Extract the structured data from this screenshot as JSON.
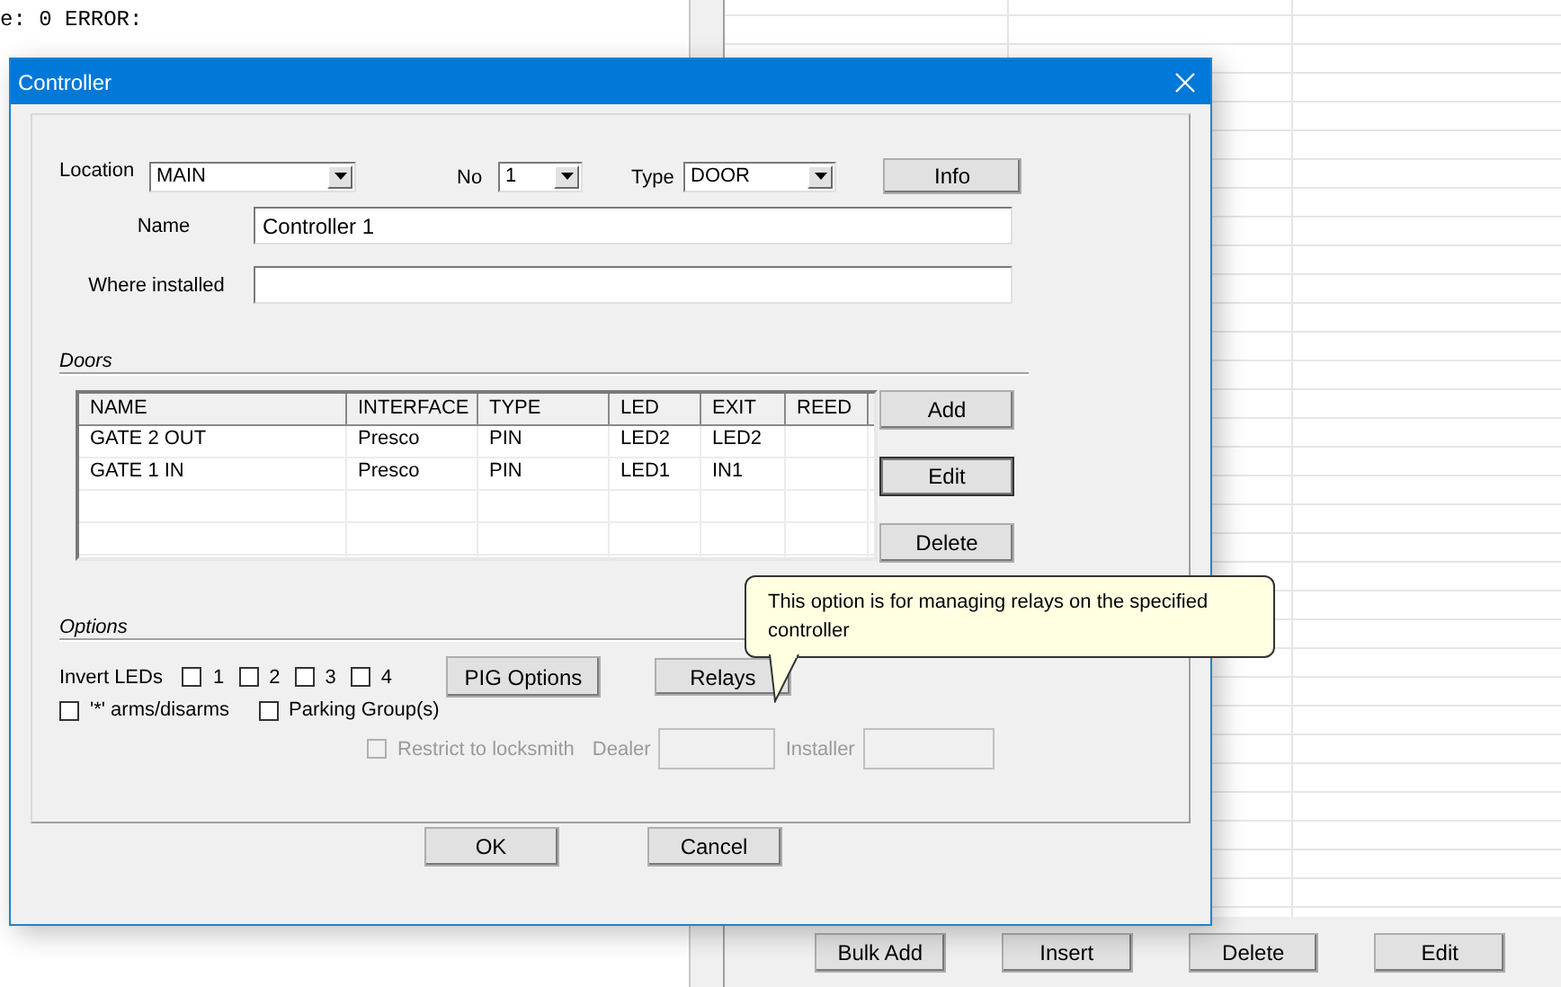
{
  "background": {
    "log_lines": [
      "e: 0 ERROR:"
    ],
    "buttons": [
      "Bulk Add",
      "Insert",
      "Delete",
      "Edit"
    ]
  },
  "dialog": {
    "title": "Controller",
    "location": {
      "label": "Location",
      "value": "MAIN"
    },
    "number": {
      "label": "No",
      "value": "1"
    },
    "type": {
      "label": "Type",
      "value": "DOOR"
    },
    "info_button": "Info",
    "name": {
      "label": "Name",
      "value": "Controller 1"
    },
    "where_installed": {
      "label": "Where installed"
    },
    "doors": {
      "label": "Doors",
      "columns": [
        "NAME",
        "INTERFACE",
        "TYPE",
        "LED",
        "EXIT",
        "REED"
      ],
      "rows": [
        [
          "GATE 2 OUT",
          "Presco",
          "PIN",
          "LED2",
          "LED2",
          ""
        ],
        [
          "GATE 1 IN",
          "Presco",
          "PIN",
          "LED1",
          "IN1",
          ""
        ]
      ],
      "buttons": [
        {
          "label": "Add",
          "focused": false
        },
        {
          "label": "Edit",
          "focused": true
        },
        {
          "label": "Delete",
          "focused": false
        }
      ]
    },
    "options": {
      "label": "Options",
      "invert_label": "Invert  LEDs",
      "invert_leds": [
        {
          "label": "1",
          "checked": false
        },
        {
          "label": "2",
          "checked": false
        },
        {
          "label": "3",
          "checked": false
        },
        {
          "label": "4",
          "checked": false
        }
      ],
      "pig_button": "PIG Options",
      "relays_button": "Relays",
      "star_arms": {
        "label": "'*' arms/disarms",
        "checked": false
      },
      "parking_groups": {
        "label": "Parking Group(s)",
        "checked": false
      },
      "restrict": {
        "label": "Restrict to locksmith",
        "checked": false,
        "disabled": true
      },
      "dealer": {
        "label": "Dealer",
        "disabled": true
      },
      "installer": {
        "label": "Installer",
        "disabled": true
      }
    },
    "tooltip": "This option is for managing relays on the specified controller",
    "buttons": [
      "OK",
      "Cancel"
    ]
  }
}
